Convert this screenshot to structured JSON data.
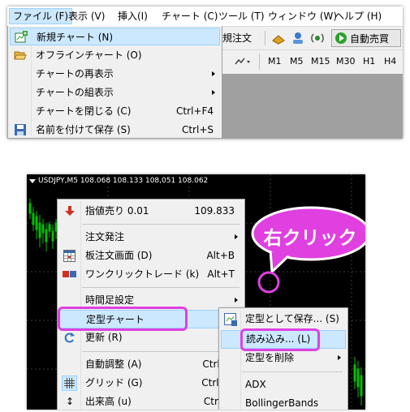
{
  "menubar": {
    "items": [
      "ファイル (F)",
      "表示 (V)",
      "挿入(I)",
      "チャート (C)",
      "ツール (T)",
      "ウィンドウ (W)",
      "ヘルプ (H)"
    ]
  },
  "toolbar": {
    "new_order_label": "規注文",
    "auto_trade_label": "自動売買",
    "timeframes": [
      "M1",
      "M5",
      "M15",
      "M30",
      "H1",
      "H4"
    ]
  },
  "file_menu": {
    "items": [
      {
        "label": "新規チャート (N)",
        "icon": "new-chart-icon",
        "highlighted": true
      },
      {
        "label": "オフラインチャート (O)",
        "icon": "open-folder-icon"
      },
      {
        "label": "チャートの再表示",
        "submenu": true
      },
      {
        "label": "チャートの組表示",
        "submenu": true
      },
      {
        "label": "チャートを閉じる (C)",
        "shortcut": "Ctrl+F4"
      },
      {
        "label": "名前を付けて保存 (S)",
        "shortcut": "Ctrl+S",
        "icon": "save-icon"
      }
    ]
  },
  "chart": {
    "title": "USDJPY,M5  108.068 108.133 108,051 108.062"
  },
  "context_menu": {
    "items": [
      {
        "label": "指値売り 0.01",
        "shortcut": "109.833",
        "icon": "sell-arrow-icon"
      },
      {
        "label": "注文発注",
        "submenu": true
      },
      {
        "label": "板注文画面 (D)",
        "shortcut": "Alt+B",
        "icon": "depth-grid-icon"
      },
      {
        "label": "ワンクリックトレード (k)",
        "shortcut": "Alt+T",
        "icon": "one-click-icon"
      },
      {
        "label": "時間足設定",
        "submenu": true
      },
      {
        "label": "定型チャート",
        "submenu": true,
        "highlighted": true
      },
      {
        "label": "更新 (R)",
        "icon": "refresh-icon"
      },
      {
        "label": "自動調整 (A)",
        "shortcut": "Ctrl+A"
      },
      {
        "label": "グリッド (G)",
        "shortcut": "Ctrl+G",
        "icon": "grid-icon"
      },
      {
        "label": "出来高 (u)",
        "shortcut": "Ctrl+L"
      }
    ]
  },
  "template_submenu": {
    "items": [
      {
        "label": "定型として保存... (S)",
        "icon": "save-template-icon"
      },
      {
        "label": "読み込み... (L)",
        "highlighted": true
      },
      {
        "label": "定型を削除",
        "submenu": true
      },
      {
        "label": "ADX"
      },
      {
        "label": "BollingerBands"
      }
    ]
  },
  "callout": {
    "text": "右クリック"
  },
  "colors": {
    "highlight_bg": "#cce8ff",
    "highlight_border": "#99d1ff",
    "annotation": "#e040e0",
    "candle_up": "#00c000"
  }
}
